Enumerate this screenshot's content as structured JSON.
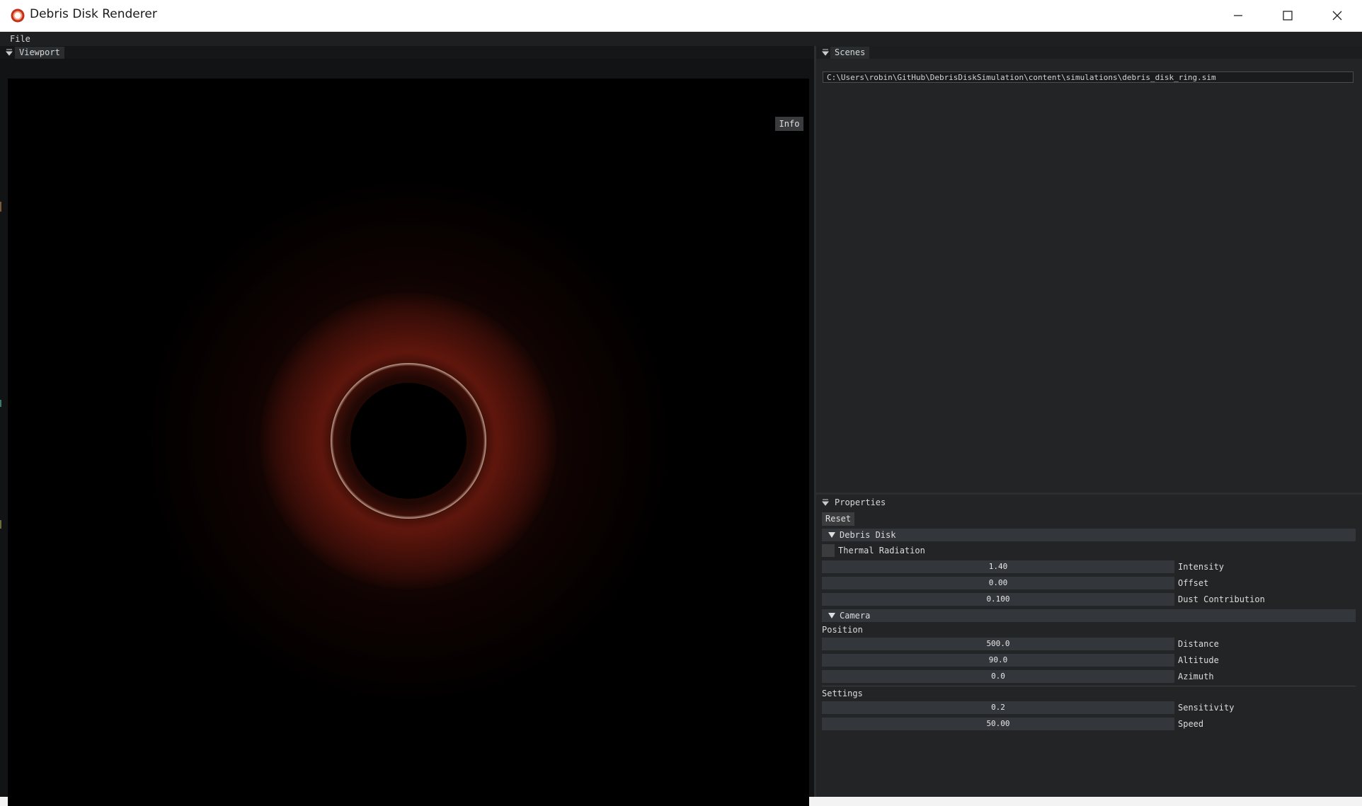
{
  "window": {
    "title": "Debris Disk Renderer",
    "controls": [
      "minimize",
      "maximize",
      "close"
    ]
  },
  "menubar": {
    "items": [
      "File"
    ]
  },
  "viewport": {
    "title": "Viewport",
    "info_button": "Info"
  },
  "scenes": {
    "title": "Scenes",
    "path": "C:\\Users\\robin\\GitHub\\DebrisDiskSimulation\\content\\simulations\\debris_disk_ring.sim"
  },
  "properties": {
    "title": "Properties",
    "reset_label": "Reset",
    "debris_disk": {
      "header": "Debris Disk",
      "thermal_radiation_label": "Thermal Radiation",
      "thermal_radiation_checked": false,
      "intensity": {
        "value": "1.40",
        "label": "Intensity"
      },
      "offset": {
        "value": "0.00",
        "label": "Offset"
      },
      "dust": {
        "value": "0.100",
        "label": "Dust Contribution"
      }
    },
    "camera": {
      "header": "Camera",
      "position_label": "Position",
      "distance": {
        "value": "500.0",
        "label": "Distance"
      },
      "altitude": {
        "value": "90.0",
        "label": "Altitude"
      },
      "azimuth": {
        "value": "0.0",
        "label": "Azimuth"
      },
      "settings_label": "Settings",
      "sensitivity": {
        "value": "0.2",
        "label": "Sensitivity"
      },
      "speed": {
        "value": "50.00",
        "label": "Speed"
      }
    }
  },
  "colors": {
    "panel_bg": "#222426",
    "frame_bg": "#33363a",
    "render_bg": "#000000",
    "disk_inner": "#ffebd2",
    "disk_outer": "#962314"
  }
}
